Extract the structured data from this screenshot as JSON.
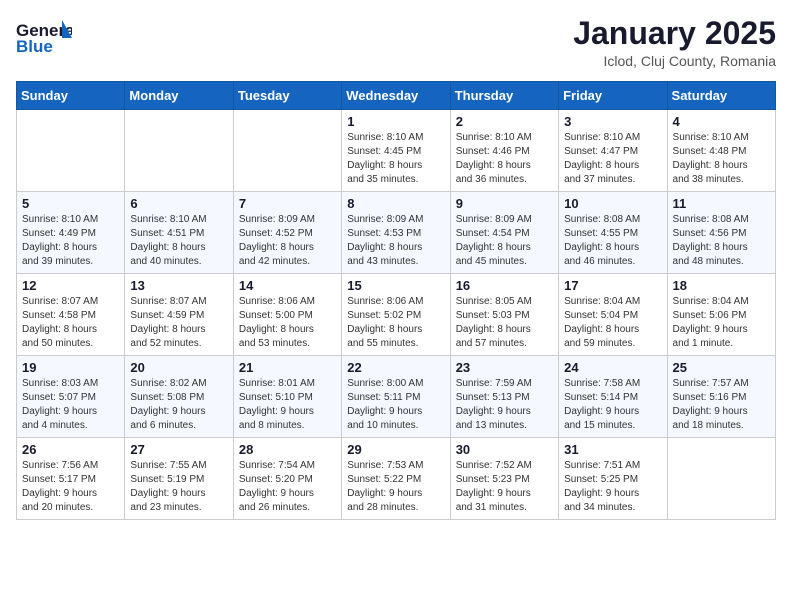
{
  "header": {
    "logo_line1": "General",
    "logo_line2": "Blue",
    "title": "January 2025",
    "location": "Iclod, Cluj County, Romania"
  },
  "weekdays": [
    "Sunday",
    "Monday",
    "Tuesday",
    "Wednesday",
    "Thursday",
    "Friday",
    "Saturday"
  ],
  "weeks": [
    [
      {
        "day": "",
        "info": ""
      },
      {
        "day": "",
        "info": ""
      },
      {
        "day": "",
        "info": ""
      },
      {
        "day": "1",
        "info": "Sunrise: 8:10 AM\nSunset: 4:45 PM\nDaylight: 8 hours\nand 35 minutes."
      },
      {
        "day": "2",
        "info": "Sunrise: 8:10 AM\nSunset: 4:46 PM\nDaylight: 8 hours\nand 36 minutes."
      },
      {
        "day": "3",
        "info": "Sunrise: 8:10 AM\nSunset: 4:47 PM\nDaylight: 8 hours\nand 37 minutes."
      },
      {
        "day": "4",
        "info": "Sunrise: 8:10 AM\nSunset: 4:48 PM\nDaylight: 8 hours\nand 38 minutes."
      }
    ],
    [
      {
        "day": "5",
        "info": "Sunrise: 8:10 AM\nSunset: 4:49 PM\nDaylight: 8 hours\nand 39 minutes."
      },
      {
        "day": "6",
        "info": "Sunrise: 8:10 AM\nSunset: 4:51 PM\nDaylight: 8 hours\nand 40 minutes."
      },
      {
        "day": "7",
        "info": "Sunrise: 8:09 AM\nSunset: 4:52 PM\nDaylight: 8 hours\nand 42 minutes."
      },
      {
        "day": "8",
        "info": "Sunrise: 8:09 AM\nSunset: 4:53 PM\nDaylight: 8 hours\nand 43 minutes."
      },
      {
        "day": "9",
        "info": "Sunrise: 8:09 AM\nSunset: 4:54 PM\nDaylight: 8 hours\nand 45 minutes."
      },
      {
        "day": "10",
        "info": "Sunrise: 8:08 AM\nSunset: 4:55 PM\nDaylight: 8 hours\nand 46 minutes."
      },
      {
        "day": "11",
        "info": "Sunrise: 8:08 AM\nSunset: 4:56 PM\nDaylight: 8 hours\nand 48 minutes."
      }
    ],
    [
      {
        "day": "12",
        "info": "Sunrise: 8:07 AM\nSunset: 4:58 PM\nDaylight: 8 hours\nand 50 minutes."
      },
      {
        "day": "13",
        "info": "Sunrise: 8:07 AM\nSunset: 4:59 PM\nDaylight: 8 hours\nand 52 minutes."
      },
      {
        "day": "14",
        "info": "Sunrise: 8:06 AM\nSunset: 5:00 PM\nDaylight: 8 hours\nand 53 minutes."
      },
      {
        "day": "15",
        "info": "Sunrise: 8:06 AM\nSunset: 5:02 PM\nDaylight: 8 hours\nand 55 minutes."
      },
      {
        "day": "16",
        "info": "Sunrise: 8:05 AM\nSunset: 5:03 PM\nDaylight: 8 hours\nand 57 minutes."
      },
      {
        "day": "17",
        "info": "Sunrise: 8:04 AM\nSunset: 5:04 PM\nDaylight: 8 hours\nand 59 minutes."
      },
      {
        "day": "18",
        "info": "Sunrise: 8:04 AM\nSunset: 5:06 PM\nDaylight: 9 hours\nand 1 minute."
      }
    ],
    [
      {
        "day": "19",
        "info": "Sunrise: 8:03 AM\nSunset: 5:07 PM\nDaylight: 9 hours\nand 4 minutes."
      },
      {
        "day": "20",
        "info": "Sunrise: 8:02 AM\nSunset: 5:08 PM\nDaylight: 9 hours\nand 6 minutes."
      },
      {
        "day": "21",
        "info": "Sunrise: 8:01 AM\nSunset: 5:10 PM\nDaylight: 9 hours\nand 8 minutes."
      },
      {
        "day": "22",
        "info": "Sunrise: 8:00 AM\nSunset: 5:11 PM\nDaylight: 9 hours\nand 10 minutes."
      },
      {
        "day": "23",
        "info": "Sunrise: 7:59 AM\nSunset: 5:13 PM\nDaylight: 9 hours\nand 13 minutes."
      },
      {
        "day": "24",
        "info": "Sunrise: 7:58 AM\nSunset: 5:14 PM\nDaylight: 9 hours\nand 15 minutes."
      },
      {
        "day": "25",
        "info": "Sunrise: 7:57 AM\nSunset: 5:16 PM\nDaylight: 9 hours\nand 18 minutes."
      }
    ],
    [
      {
        "day": "26",
        "info": "Sunrise: 7:56 AM\nSunset: 5:17 PM\nDaylight: 9 hours\nand 20 minutes."
      },
      {
        "day": "27",
        "info": "Sunrise: 7:55 AM\nSunset: 5:19 PM\nDaylight: 9 hours\nand 23 minutes."
      },
      {
        "day": "28",
        "info": "Sunrise: 7:54 AM\nSunset: 5:20 PM\nDaylight: 9 hours\nand 26 minutes."
      },
      {
        "day": "29",
        "info": "Sunrise: 7:53 AM\nSunset: 5:22 PM\nDaylight: 9 hours\nand 28 minutes."
      },
      {
        "day": "30",
        "info": "Sunrise: 7:52 AM\nSunset: 5:23 PM\nDaylight: 9 hours\nand 31 minutes."
      },
      {
        "day": "31",
        "info": "Sunrise: 7:51 AM\nSunset: 5:25 PM\nDaylight: 9 hours\nand 34 minutes."
      },
      {
        "day": "",
        "info": ""
      }
    ]
  ]
}
